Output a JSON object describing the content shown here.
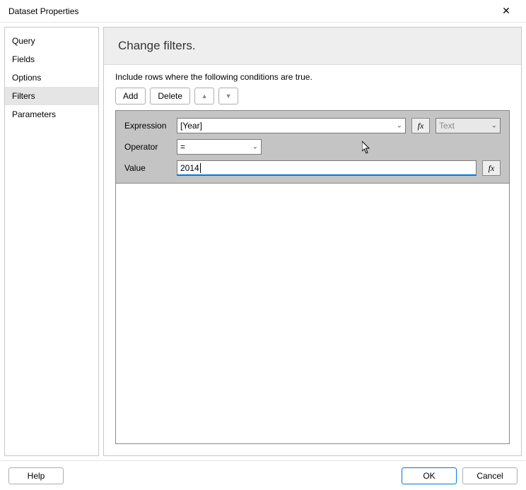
{
  "window": {
    "title": "Dataset Properties",
    "close": "✕"
  },
  "sidebar": {
    "items": [
      {
        "label": "Query"
      },
      {
        "label": "Fields"
      },
      {
        "label": "Options"
      },
      {
        "label": "Filters",
        "selected": true
      },
      {
        "label": "Parameters"
      }
    ]
  },
  "panel": {
    "heading": "Change filters.",
    "instruction": "Include rows where the following conditions are true.",
    "add": "Add",
    "delete": "Delete",
    "labels": {
      "expression": "Expression",
      "operator": "Operator",
      "value": "Value"
    },
    "filter": {
      "expression": "[Year]",
      "operator": "=",
      "type": "Text",
      "value": "2014"
    },
    "fx": "fx"
  },
  "footer": {
    "help": "Help",
    "ok": "OK",
    "cancel": "Cancel"
  },
  "icons": {
    "up": "▲",
    "down": "▼",
    "caret": "⌄"
  }
}
